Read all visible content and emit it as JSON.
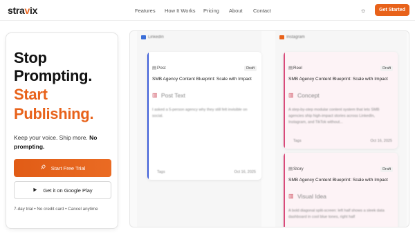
{
  "nav": {
    "logo_prefix": "stra",
    "logo_mid": "v",
    "logo_suffix": "ix",
    "links": [
      "Features",
      "How It Works",
      "Pricing",
      "About",
      "Contact"
    ],
    "theme_icon": "sun-icon",
    "cta_label": "Get Started"
  },
  "hero": {
    "line1": "Stop",
    "line2": "Prompting.",
    "line3": "Start",
    "line4": "Publishing.",
    "sub_plain": "Keep your voice. Ship more. ",
    "sub_bold": "No prompting.",
    "trial_icon": "rocket-icon",
    "trial_label": "Start Free Trial",
    "play_icon": "play-icon",
    "play_label": "Get it on Google Play",
    "fine": "7-day trial • No credit card • Cancel anytime"
  },
  "board": {
    "columns": [
      {
        "name": "LinkedIn",
        "color": "#3b6fd8"
      },
      {
        "name": "Instagram",
        "color": "#e8621a"
      }
    ],
    "cards": [
      {
        "type": "Post",
        "status": "Draft",
        "title": "SMB Agency Content Blueprint: Scale with Impact",
        "section": "Post Text",
        "body": "I asked a 5-person agency why they still felt invisible on social.",
        "tags": "Tags",
        "date": "Oct 16, 2025",
        "accent": "#3b5bd8"
      },
      {
        "type": "Reel",
        "status": "Draft",
        "title": "SMB Agency Content Blueprint: Scale with Impact",
        "section": "Concept",
        "body": "A step-by-step modular content system that lets SMB agencies ship high-impact stories across LinkedIn, Instagram, and TikTok without...",
        "tags": "Tags",
        "date": "Oct 16, 2025",
        "accent": "#d94a7a"
      },
      {
        "type": "Story",
        "status": "Draft",
        "title": "SMB Agency Content Blueprint: Scale with Impact",
        "section": "Visual Idea",
        "body": "A bold diagonal split-screen: left half shows a sleek data dashboard in cool blue tones, right half",
        "accent": "#d94a7a"
      }
    ]
  },
  "colors": {
    "brand": "#e8621a",
    "linkedin": "#3b5bd8",
    "instagram": "#d94a7a"
  }
}
